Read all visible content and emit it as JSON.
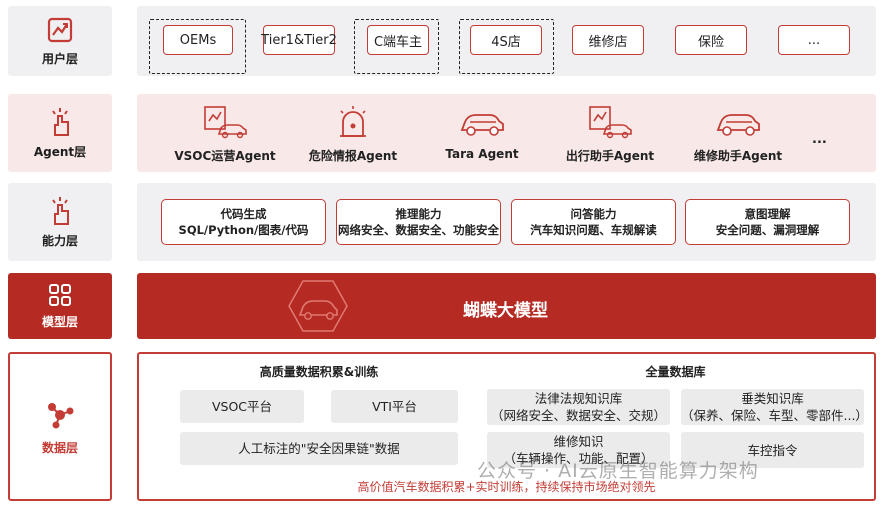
{
  "layers": {
    "user": "用户层",
    "agent": "Agent层",
    "capability": "能力层",
    "model": "模型层",
    "data": "数据层"
  },
  "user_row": [
    "OEMs",
    "Tier1&Tier2",
    "C端车主",
    "4S店",
    "维修店",
    "保险",
    "..."
  ],
  "agents": [
    "VSOC运营Agent",
    "危险情报Agent",
    "Tara Agent",
    "出行助手Agent",
    "维修助手Agent",
    "..."
  ],
  "capabilities": [
    {
      "title": "代码生成",
      "desc": "SQL/Python/图表/代码"
    },
    {
      "title": "推理能力",
      "desc": "网络安全、数据安全、功能安全"
    },
    {
      "title": "问答能力",
      "desc": "汽车知识问题、车规解读"
    },
    {
      "title": "意图理解",
      "desc": "安全问题、漏洞理解"
    }
  ],
  "model": {
    "name": "蝴蝶大模型"
  },
  "data": {
    "left_title": "高质量数据积累&训练",
    "right_title": "全量数据库",
    "vsoc": "VSOC平台",
    "vti": "VTI平台",
    "annotation": "人工标注的\"安全因果链\"数据",
    "law_title": "法律法规知识库",
    "law_desc": "（网络安全、数据安全、交规）",
    "vertical_title": "垂类知识库",
    "vertical_desc": "（保养、保险、车型、零部件...）",
    "repair_title": "维修知识",
    "repair_desc": "（车辆操作、功能、配置）",
    "control": "车控指令",
    "footer": "高价值汽车数据积累+实时训练，持续保持市场绝对领先"
  },
  "watermark": "公众号 · AI云原生智能算力架构",
  "colors": {
    "accent": "#c33d36",
    "model_bg": "#b52a22",
    "pink_bg": "#f8e9e8",
    "gray_bg": "#f0f0f2"
  }
}
